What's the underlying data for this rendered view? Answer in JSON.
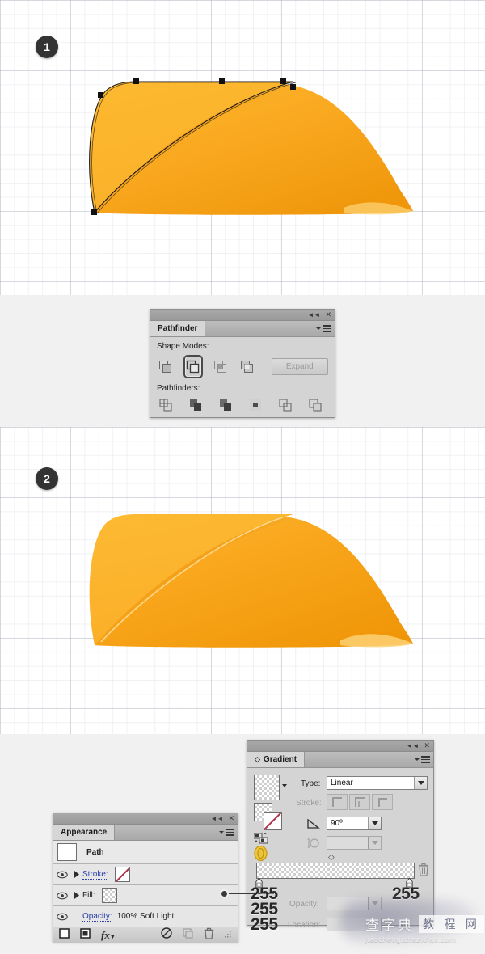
{
  "steps": [
    {
      "number": "1"
    },
    {
      "number": "2"
    }
  ],
  "pathfinder_panel": {
    "tab_label": "Pathfinder",
    "shape_modes_label": "Shape Modes:",
    "pathfinders_label": "Pathfinders:",
    "expand_label": "Expand",
    "collapse_icon": "collapse-icon",
    "close_icon": "close-icon",
    "menu_icon": "panel-menu-icon",
    "shape_modes": [
      {
        "name": "unite",
        "selected": false
      },
      {
        "name": "minus-front",
        "selected": true
      },
      {
        "name": "intersect",
        "selected": false
      },
      {
        "name": "exclude",
        "selected": false
      }
    ],
    "pathfinders": [
      {
        "name": "divide"
      },
      {
        "name": "trim"
      },
      {
        "name": "merge"
      },
      {
        "name": "crop"
      },
      {
        "name": "outline"
      },
      {
        "name": "minus-back"
      }
    ]
  },
  "appearance_panel": {
    "tab_label": "Appearance",
    "collapse_icon": "collapse-icon",
    "close_icon": "close-icon",
    "menu_icon": "panel-menu-icon",
    "object_label": "Path",
    "rows": [
      {
        "label": "Stroke:",
        "value": "",
        "swatch": "none"
      },
      {
        "label": "Fill:",
        "value": "",
        "swatch": "gradient"
      }
    ],
    "opacity_label": "Opacity:",
    "opacity_value": "100% Soft Light",
    "footer_icons": [
      "add-new-stroke-icon",
      "add-new-fill-icon",
      "add-effect-icon",
      "clear-appearance-icon",
      "duplicate-item-icon",
      "delete-item-icon",
      "resize-grip-icon"
    ]
  },
  "gradient_panel": {
    "tab_label": "Gradient",
    "collapse_icon": "collapse-icon",
    "close_icon": "close-icon",
    "menu_icon": "panel-menu-icon",
    "type_label": "Type:",
    "type_value": "Linear",
    "stroke_label": "Stroke:",
    "angle_label": "angle-icon",
    "angle_value": "90º",
    "aspect_label": "aspect-ratio-icon",
    "aspect_value": "",
    "opacity_label": "Opacity:",
    "opacity_value": "",
    "location_label": "Location:",
    "location_value": "",
    "stroke_options": [
      "stroke-within",
      "stroke-along",
      "stroke-across"
    ],
    "delete_icon": "delete-stop-icon",
    "stops": [
      {
        "position": 0,
        "value": "255\n255\n255"
      },
      {
        "position": 100,
        "value": "255"
      }
    ]
  },
  "callout": {
    "left_values": [
      "255",
      "255",
      "255"
    ],
    "right_value": "255"
  },
  "watermark": {
    "cn_text": "查字典",
    "cn_box_text": "教 程 网",
    "url": "jiaocheng.chazidian.com"
  },
  "colors": {
    "shape_light": "#fbb229",
    "shape_mid": "#f9a826",
    "shape_dark": "#f09a08",
    "shape_edge": "#fdd06a",
    "badge_bg": "#333333",
    "panel_bg": "#d4d4d4",
    "link_blue": "#2b3ea8"
  }
}
